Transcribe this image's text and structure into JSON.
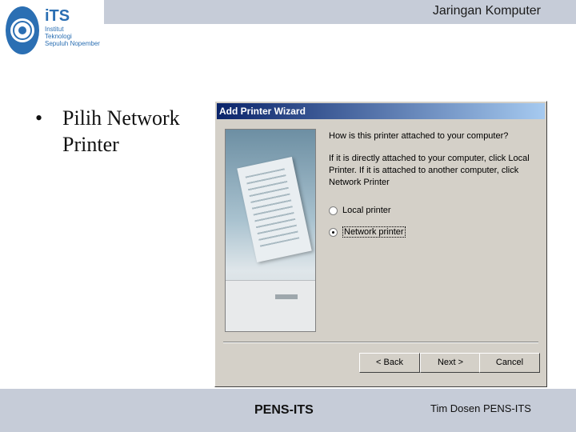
{
  "header": {
    "title": "Jaringan Komputer"
  },
  "logo": {
    "name": "iTS",
    "lines": [
      "Institut",
      "Teknologi",
      "Sepuluh Nopember"
    ]
  },
  "slide": {
    "bullet": "•",
    "text": "Pilih Network Printer"
  },
  "dialog": {
    "title": "Add Printer Wizard",
    "question": "How is this printer attached to your computer?",
    "instructions": "If it is directly attached to your computer, click Local Printer. If it is attached to another computer, click Network Printer",
    "options": [
      {
        "label": "Local printer",
        "selected": false
      },
      {
        "label": "Network printer",
        "selected": true
      }
    ],
    "buttons": {
      "back": "< Back",
      "next": "Next >",
      "cancel": "Cancel"
    }
  },
  "footer": {
    "center": "PENS-ITS",
    "right": "Tim Dosen PENS-ITS"
  },
  "colors": {
    "band": "#c6ccd8",
    "titlebar": "#0a246a",
    "dialog_bg": "#d4d0c8",
    "logo_blue": "#2b6fb3"
  }
}
